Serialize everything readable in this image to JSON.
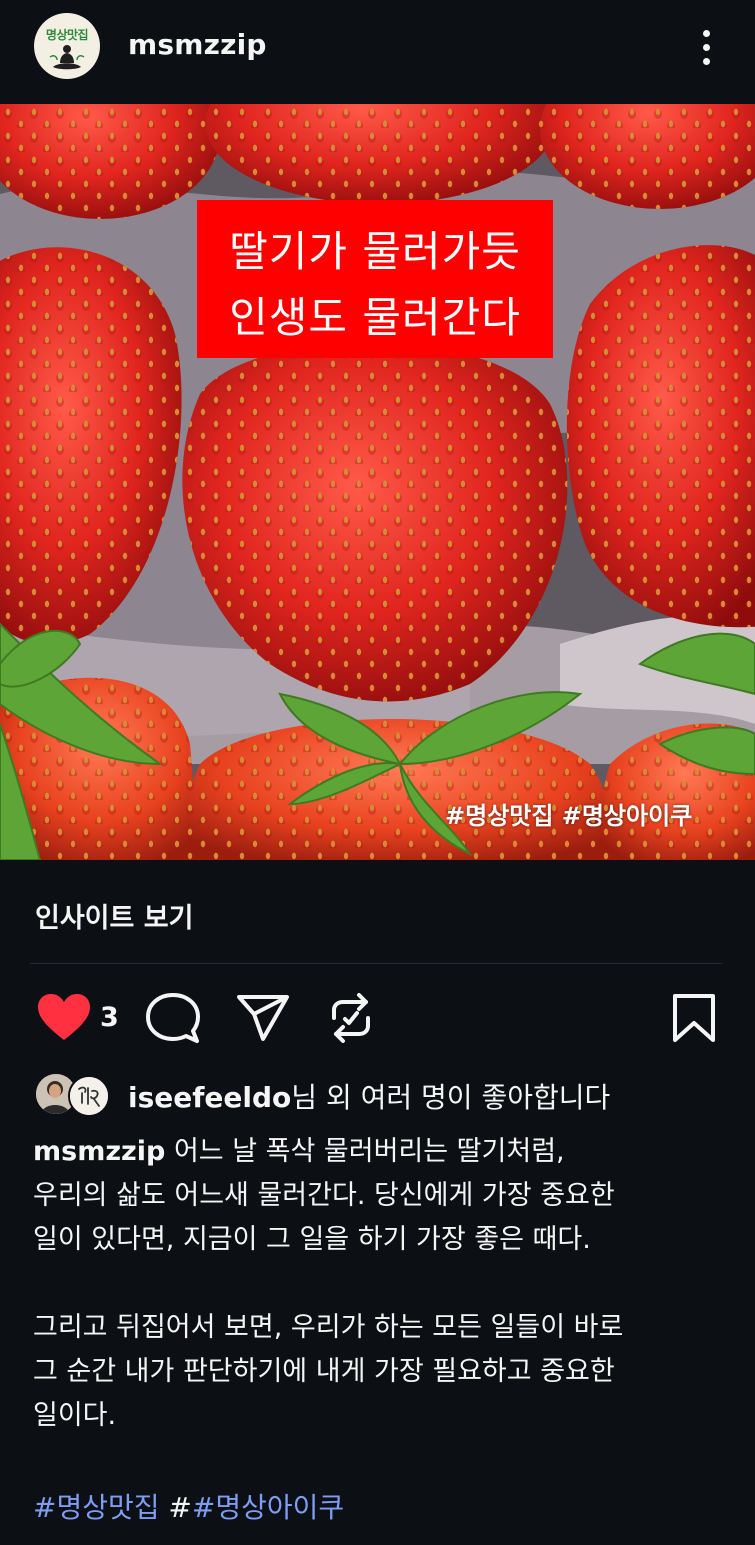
{
  "header": {
    "username": "msmzzip",
    "avatar_logo_text": "명상맛집",
    "more_icon": "more-vertical-icon"
  },
  "post": {
    "image_caption_line1": "딸기가 물러가듯",
    "image_caption_line2": "인생도 물러간다",
    "image_watermark": "#명상맛집 #명상아이쿠",
    "caption_bg_color": "#ff0000"
  },
  "insights": {
    "label": "인사이트 보기"
  },
  "actions": {
    "like_count": "3",
    "like_icon": "heart-filled-icon",
    "comment_icon": "comment-icon",
    "share_icon": "send-icon",
    "repost_icon": "repost-icon",
    "save_icon": "bookmark-icon",
    "like_color": "#ff3040"
  },
  "likes": {
    "liker_name": "iseefeeldo",
    "suffix": "님 외 여러 명이 좋아합니다"
  },
  "caption": {
    "username": "msmzzip",
    "line1_text": " 어느 날 폭삭 물러버리는 딸기처럼,",
    "line2": "우리의 삶도 어느새 물러간다. 당신에게 가장 중요한",
    "line3": "일이 있다면, 지금이 그 일을 하기 가장 좋은 때다.",
    "line4": "그리고 뒤집어서 보면, 우리가 하는 모든 일들이 바로",
    "line5": "그 순간 내가 판단하기에 내게 가장 필요하고 중요한",
    "line6": "일이다."
  },
  "hashtags": {
    "tag1": "#명상맛집",
    "separator": " #",
    "tag2": "#명상아이쿠",
    "link_color": "#7f9cf5"
  }
}
